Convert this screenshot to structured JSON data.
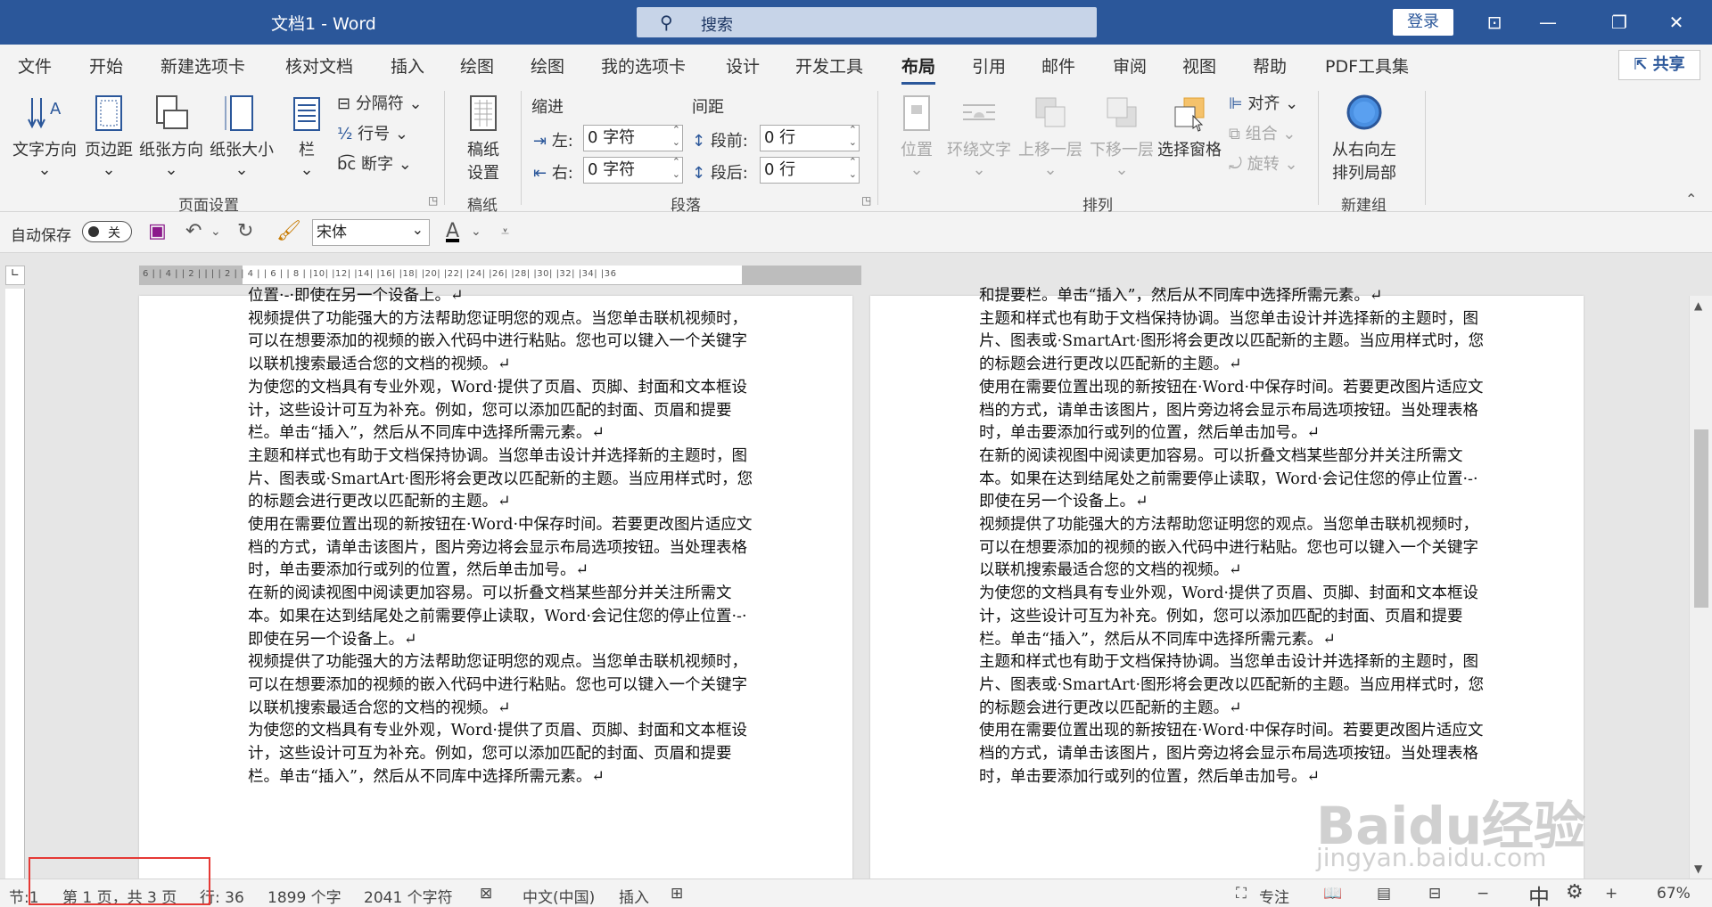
{
  "titlebar": {
    "doc_title": "文档1  -  Word",
    "search_placeholder": "搜索",
    "login": "登录"
  },
  "tabs": [
    {
      "label": "文件"
    },
    {
      "label": "开始"
    },
    {
      "label": "新建选项卡"
    },
    {
      "label": "核对文档"
    },
    {
      "label": "插入"
    },
    {
      "label": "绘图"
    },
    {
      "label": "绘图"
    },
    {
      "label": "我的选项卡"
    },
    {
      "label": "设计"
    },
    {
      "label": "开发工具"
    },
    {
      "label": "布局"
    },
    {
      "label": "引用"
    },
    {
      "label": "邮件"
    },
    {
      "label": "审阅"
    },
    {
      "label": "视图"
    },
    {
      "label": "帮助"
    },
    {
      "label": "PDF工具集"
    }
  ],
  "share": "共享",
  "ribbon": {
    "page_setup": {
      "text_direction": "文字方向",
      "margins": "页边距",
      "orientation": "纸张方向",
      "size": "纸张大小",
      "columns": "栏",
      "breaks": "分隔符",
      "line_numbers": "行号",
      "hyphenation": "断字",
      "group_label": "页面设置"
    },
    "draft": {
      "draft_settings_line1": "稿纸",
      "draft_settings_line2": "设置",
      "group_label": "稿纸"
    },
    "paragraph": {
      "indent_label": "缩进",
      "spacing_label": "间距",
      "left_label": "左:",
      "left_value": "0 字符",
      "right_label": "右:",
      "right_value": "0 字符",
      "before_label": "段前:",
      "before_value": "0 行",
      "after_label": "段后:",
      "after_value": "0 行",
      "group_label": "段落"
    },
    "arrange": {
      "position": "位置",
      "wrap_text": "环绕文字",
      "bring_forward": "上移一层",
      "send_backward": "下移一层",
      "selection_pane": "选择窗格",
      "align": "对齐",
      "group": "组合",
      "rotate": "旋转",
      "group_label": "排列"
    },
    "new_group": {
      "rtl_line1": "从右向左",
      "rtl_line2": "排列局部",
      "group_label": "新建组"
    }
  },
  "qat": {
    "autosave": "自动保存",
    "toggle": "关",
    "font": "宋体"
  },
  "ruler": {
    "ticks": "6 |  | 4 |  | 2 |  |  |  | 2 |  | 4 |  | 6 |  | 8 |  |10|  |12|  |14|  |16|  |18|  |20|  |22|  |24|  |26|  |28|  |30|  |32|  |34|  |36"
  },
  "page_left": {
    "paragraphs": [
      "位置·-·即使在另一个设备上。↵",
      "视频提供了功能强大的方法帮助您证明您的观点。当您单击联机视频时，可以在想要添加的视频的嵌入代码中进行粘贴。您也可以键入一个关键字以联机搜索最适合您的文档的视频。↵",
      "为使您的文档具有专业外观，Word·提供了页眉、页脚、封面和文本框设计，这些设计可互为补充。例如，您可以添加匹配的封面、页眉和提要栏。单击“插入”，然后从不同库中选择所需元素。↵",
      "主题和样式也有助于文档保持协调。当您单击设计并选择新的主题时，图片、图表或·SmartArt·图形将会更改以匹配新的主题。当应用样式时，您的标题会进行更改以匹配新的主题。↵",
      "使用在需要位置出现的新按钮在·Word·中保存时间。若要更改图片适应文档的方式，请单击该图片，图片旁边将会显示布局选项按钮。当处理表格时，单击要添加行或列的位置，然后单击加号。↵",
      "在新的阅读视图中阅读更加容易。可以折叠文档某些部分并关注所需文本。如果在达到结尾处之前需要停止读取，Word·会记住您的停止位置·-·即使在另一个设备上。↵",
      "视频提供了功能强大的方法帮助您证明您的观点。当您单击联机视频时，可以在想要添加的视频的嵌入代码中进行粘贴。您也可以键入一个关键字以联机搜索最适合您的文档的视频。↵",
      "为使您的文档具有专业外观，Word·提供了页眉、页脚、封面和文本框设计，这些设计可互为补充。例如，您可以添加匹配的封面、页眉和提要栏。单击“插入”，然后从不同库中选择所需元素。↵"
    ]
  },
  "page_right": {
    "paragraphs": [
      "和提要栏。单击“插入”，然后从不同库中选择所需元素。↵",
      "主题和样式也有助于文档保持协调。当您单击设计并选择新的主题时，图片、图表或·SmartArt·图形将会更改以匹配新的主题。当应用样式时，您的标题会进行更改以匹配新的主题。↵",
      "使用在需要位置出现的新按钮在·Word·中保存时间。若要更改图片适应文档的方式，请单击该图片，图片旁边将会显示布局选项按钮。当处理表格时，单击要添加行或列的位置，然后单击加号。↵",
      "在新的阅读视图中阅读更加容易。可以折叠文档某些部分并关注所需文本。如果在达到结尾处之前需要停止读取，Word·会记住您的停止位置·-·即使在另一个设备上。↵",
      "视频提供了功能强大的方法帮助您证明您的观点。当您单击联机视频时，可以在想要添加的视频的嵌入代码中进行粘贴。您也可以键入一个关键字以联机搜索最适合您的文档的视频。↵",
      "为使您的文档具有专业外观，Word·提供了页眉、页脚、封面和文本框设计，这些设计可互为补充。例如，您可以添加匹配的封面、页眉和提要栏。单击“插入”，然后从不同库中选择所需元素。↵",
      "主题和样式也有助于文档保持协调。当您单击设计并选择新的主题时，图片、图表或·SmartArt·图形将会更改以匹配新的主题。当应用样式时，您的标题会进行更改以匹配新的主题。↵",
      "使用在需要位置出现的新按钮在·Word·中保存时间。若要更改图片适应文档的方式，请单击该图片，图片旁边将会显示布局选项按钮。当处理表格时，单击要添加行或列的位置，然后单击加号。↵"
    ]
  },
  "status": {
    "section": "节:1",
    "page": "第 1 页，共 3 页",
    "line": "行: 36",
    "words": "1899 个字",
    "chars": "2041 个字符",
    "language": "中文(中国)",
    "insert": "插入",
    "focus": "专注",
    "ime": "中",
    "zoom_minus": "−",
    "zoom_plus": "+",
    "zoom": "67%"
  },
  "watermark": {
    "big": "Baidu经验",
    "small": "jingyan.baidu.com"
  },
  "colors": {
    "title_bar": "#2b579a",
    "highlight": "#e53935"
  }
}
